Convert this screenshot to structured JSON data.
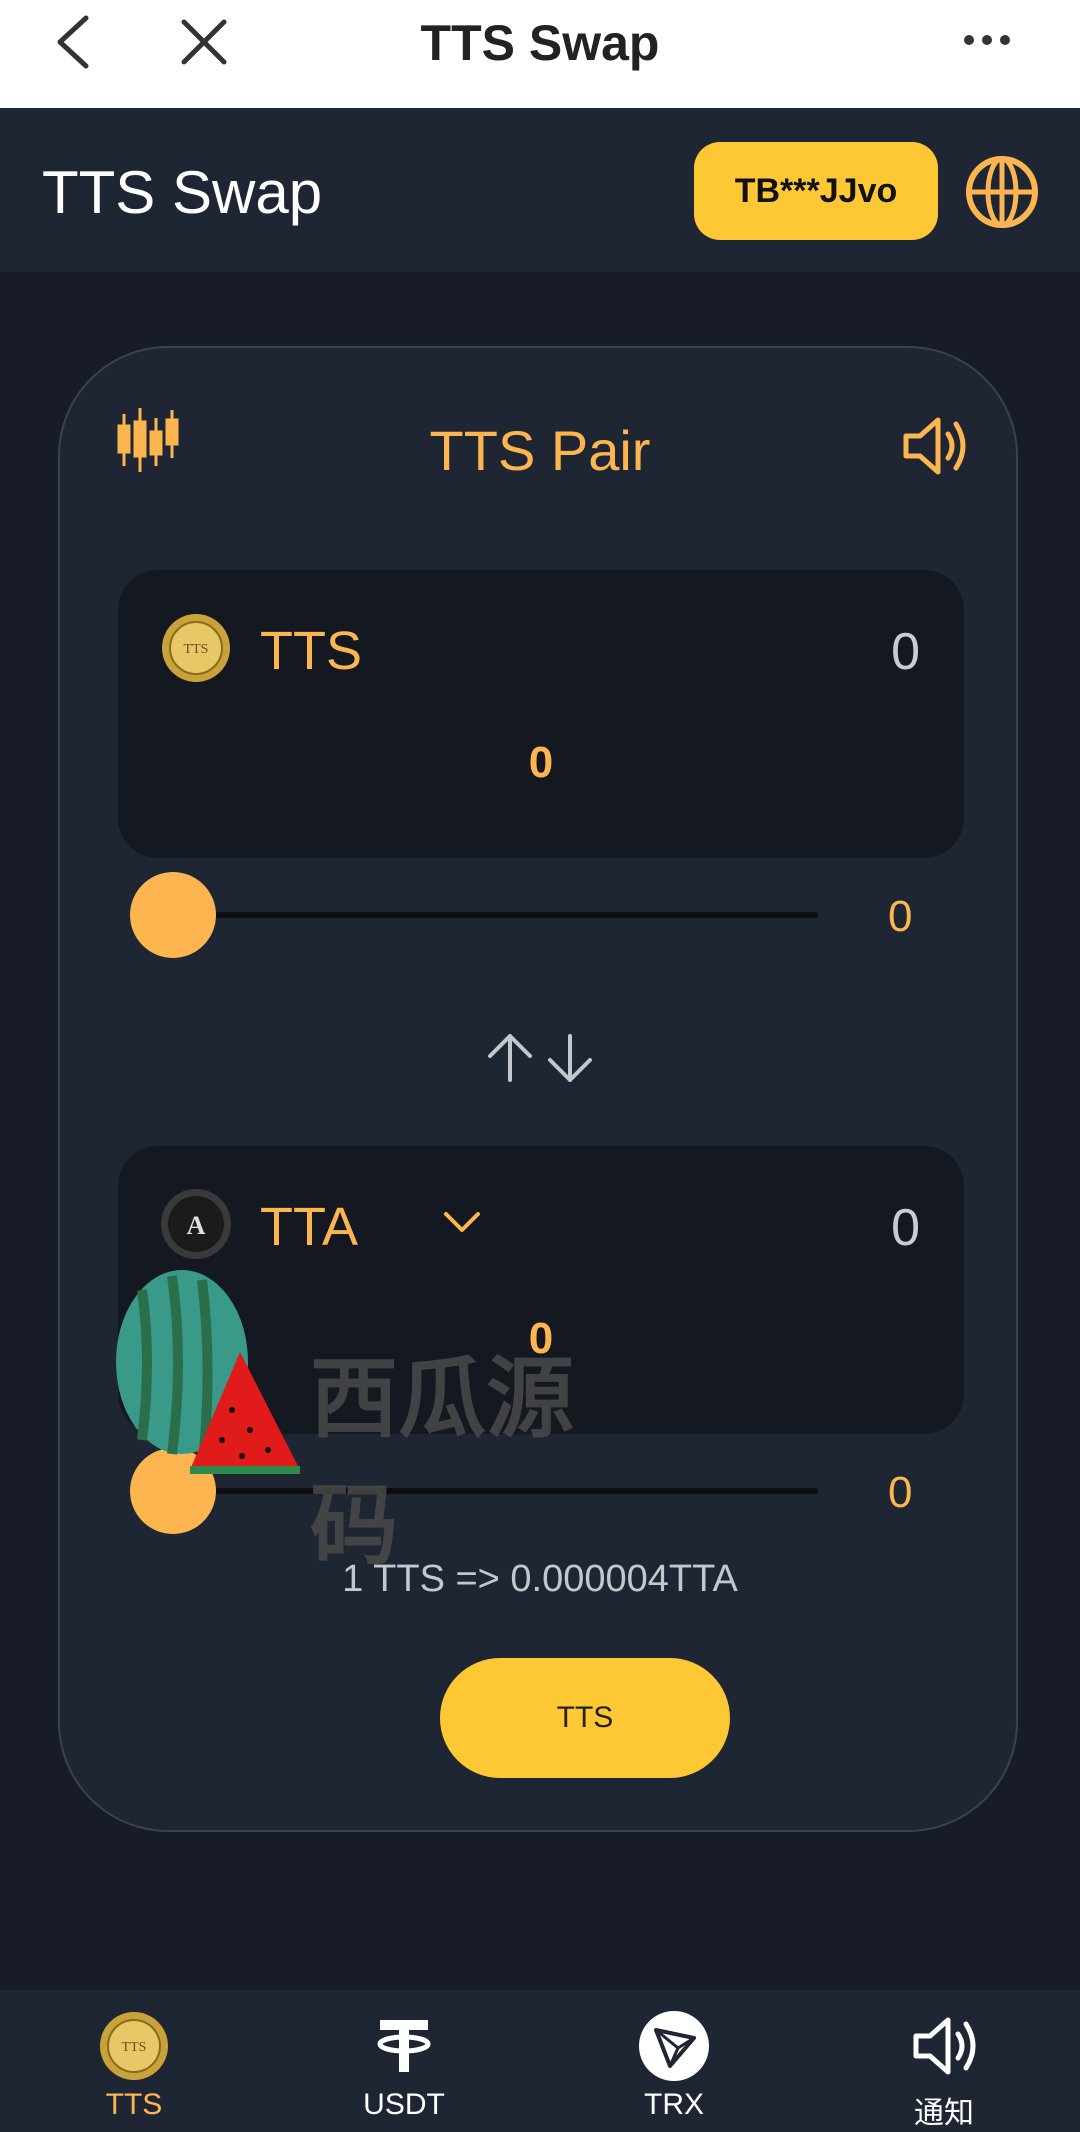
{
  "topbar": {
    "title": "TTS Swap"
  },
  "header": {
    "brand": "TTS Swap",
    "wallet_label": "TB***JJvo"
  },
  "card": {
    "title": "TTS Pair",
    "from_token": {
      "name": "TTS",
      "balance": "0",
      "amount": "0",
      "slider_value": "0",
      "slider_fraction": 0
    },
    "to_token": {
      "name": "TTA",
      "balance": "0",
      "amount": "0",
      "slider_value": "0",
      "slider_fraction": 0
    },
    "rate": "1 TTS => 0.000004TTA",
    "swap_button_label": "TTS"
  },
  "watermark": {
    "text": "西瓜源码"
  },
  "bottom_nav": {
    "items": [
      {
        "label": "TTS",
        "icon": "tts-coin-icon",
        "active": true
      },
      {
        "label": "USDT",
        "icon": "tether-icon",
        "active": false
      },
      {
        "label": "TRX",
        "icon": "tron-icon",
        "active": false
      },
      {
        "label": "通知",
        "icon": "speaker-icon",
        "active": false
      }
    ]
  },
  "colors": {
    "accent": "#fdb64f",
    "button": "#fdc833",
    "background": "#171c26",
    "panel": "#1f2633",
    "input": "#141820"
  }
}
